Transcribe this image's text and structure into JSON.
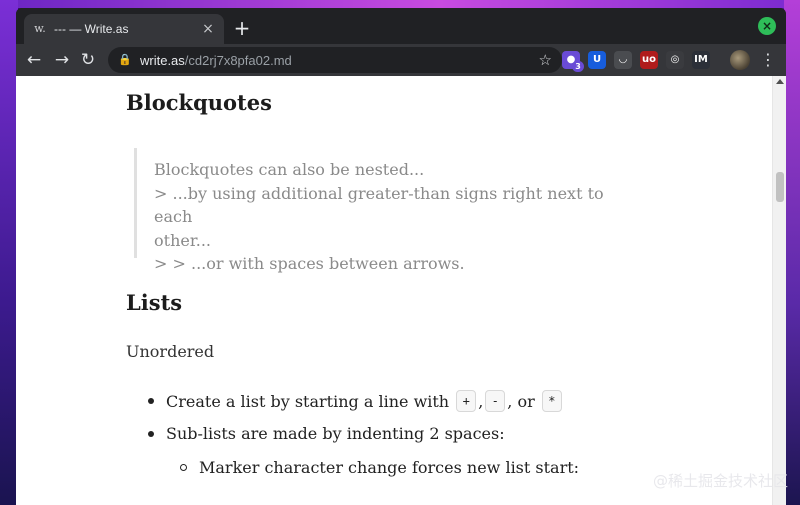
{
  "tab": {
    "favicon": "w.",
    "title": "--- — Write.as",
    "close_icon": "×"
  },
  "new_tab_icon": "+",
  "window_close_icon": "×",
  "toolbar": {
    "back_icon": "←",
    "forward_icon": "→",
    "reload_icon": "↻",
    "url_host": "write.as",
    "url_path": "/cd2rj7x8pfa02.md",
    "bookmark_icon": "☆",
    "extensions": [
      {
        "name": "grape-extension",
        "glyph": "●",
        "color": "#6a4bd6",
        "badge": "3"
      },
      {
        "name": "bitwarden-extension",
        "glyph": "U",
        "color": "#175ddc"
      },
      {
        "name": "pocket-extension",
        "glyph": "◡",
        "color": "#4a4c50"
      },
      {
        "name": "ublock-extension",
        "glyph": "uo",
        "color": "#b01c1c"
      },
      {
        "name": "ghostery-extension",
        "glyph": "◎",
        "color": "#3a3b3f"
      },
      {
        "name": "stylus-extension",
        "glyph": "IM",
        "color": "#2b2f38"
      }
    ],
    "menu_icon": "⋮"
  },
  "page": {
    "heading_blockquotes": "Blockquotes",
    "blockquote_lines": [
      "Blockquotes can also be nested...",
      "> ...by using additional greater-than signs right next to each",
      "other...",
      "> > ...or with spaces between arrows."
    ],
    "heading_lists": "Lists",
    "subheading_unordered": "Unordered",
    "list_item_1_prefix": "Create a list by starting a line with",
    "list_item_1_codes": [
      "+",
      "-",
      "*"
    ],
    "list_item_1_sep_1": ",",
    "list_item_1_sep_2": ", or",
    "list_item_2": "Sub-lists are made by indenting 2 spaces:",
    "list_item_3": "Marker character change forces new list start:"
  },
  "watermark": "@稀土掘金技术社区"
}
